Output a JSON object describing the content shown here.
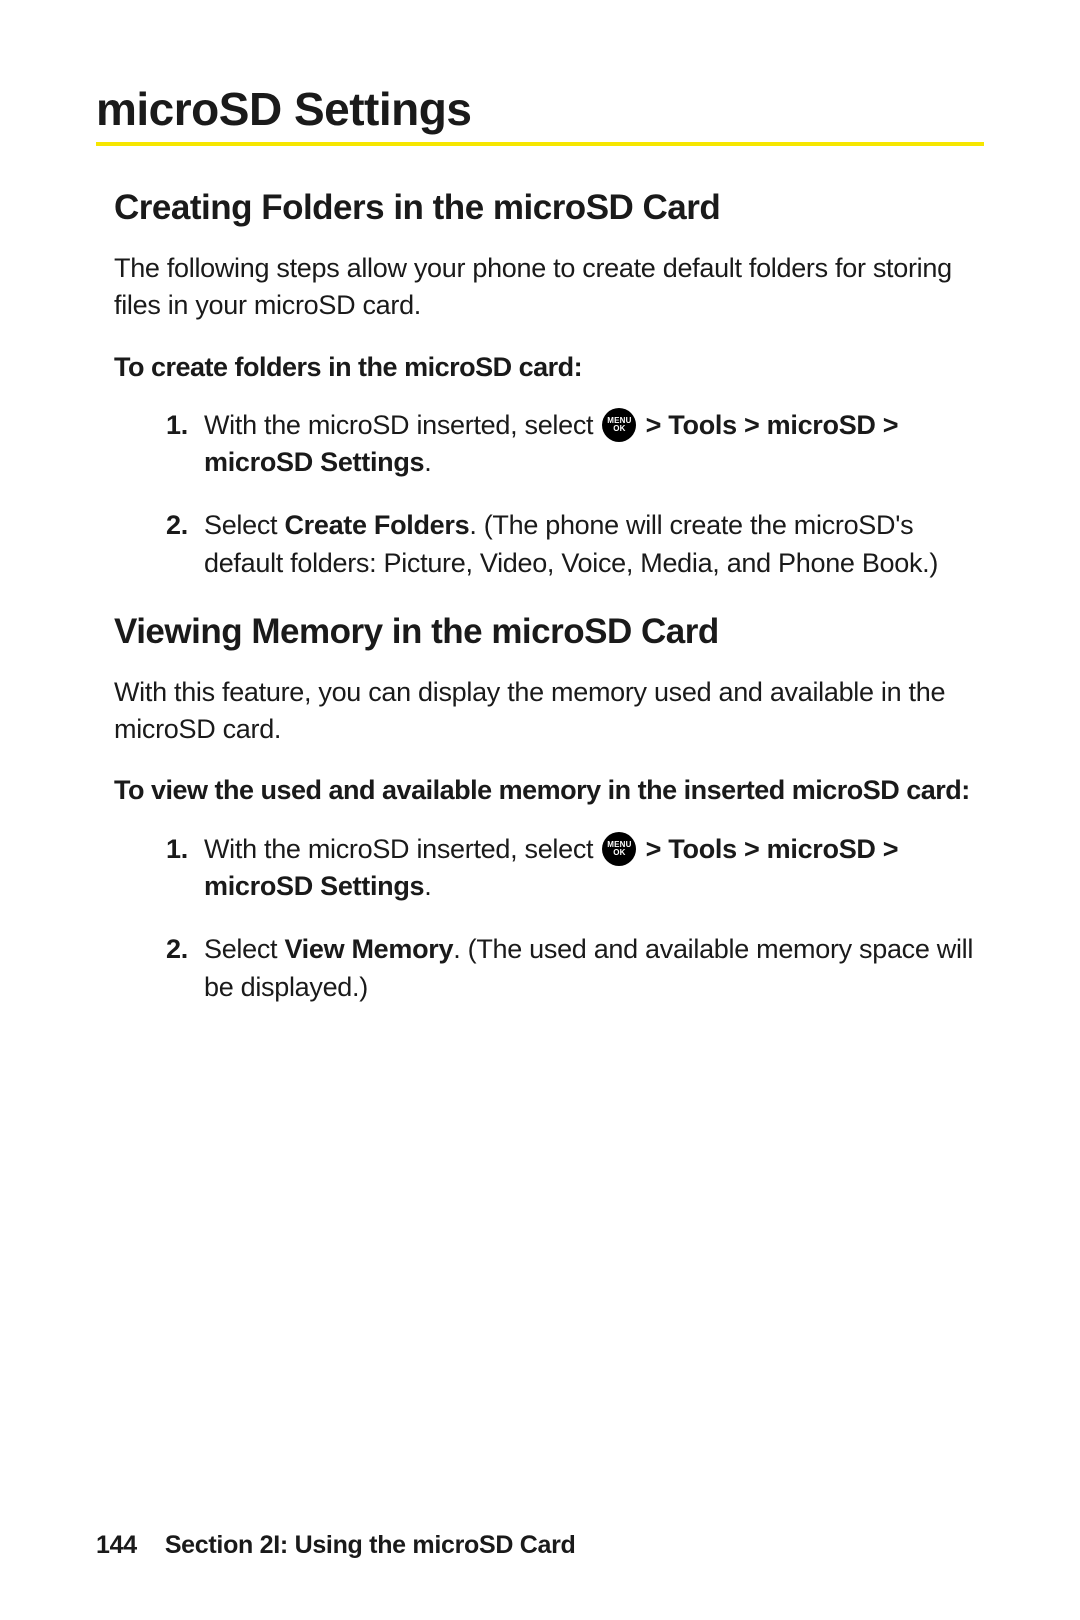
{
  "h1": "microSD Settings",
  "section1": {
    "h2": "Creating Folders in the microSD Card",
    "intro": "The following steps allow your phone to create default folders for storing files in your microSD card.",
    "lead": "To create folders in the microSD card:",
    "step1_a": "With the microSD inserted, select ",
    "step1_b": " > Tools > microSD > microSD Settings",
    "step1_c": ".",
    "step2_a": "Select ",
    "step2_b": "Create Folders",
    "step2_c": ". (The phone will create the microSD's default folders: Picture, Video, Voice, Media, and Phone Book.)"
  },
  "section2": {
    "h2": "Viewing Memory in the microSD Card",
    "intro": "With this feature, you can display the memory used and available in the microSD card.",
    "lead": "To view the used and available memory in the inserted microSD card:",
    "step1_a": "With the microSD inserted, select ",
    "step1_b": " > Tools > microSD > microSD Settings",
    "step1_c": ".",
    "step2_a": "Select ",
    "step2_b": "View Memory",
    "step2_c": ". (The used and available memory space will be displayed.)"
  },
  "icon": {
    "line1": "MENU",
    "line2": "OK"
  },
  "footer": {
    "page": "144",
    "section": "Section 2I: Using the microSD Card"
  }
}
